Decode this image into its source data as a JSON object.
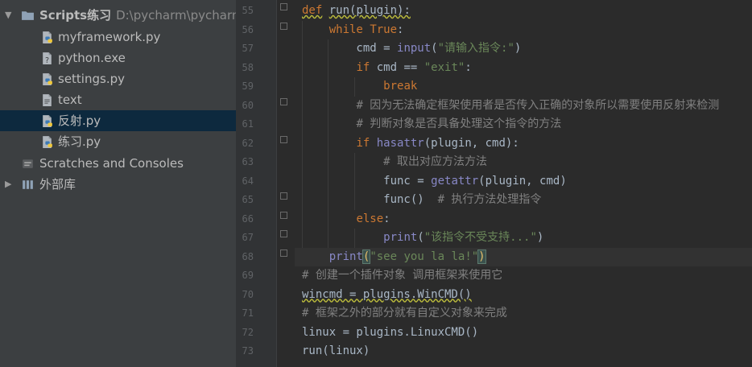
{
  "project_tree": {
    "root": {
      "name": "Scripts练习",
      "path": "D:\\pycharm\\pycharmw"
    },
    "files": [
      {
        "name": "myframework.py",
        "icon": "python-file-icon",
        "selected": false
      },
      {
        "name": "python.exe",
        "icon": "unknown-file-icon",
        "selected": false
      },
      {
        "name": "settings.py",
        "icon": "python-file-icon",
        "selected": false
      },
      {
        "name": "text",
        "icon": "text-file-icon",
        "selected": false
      },
      {
        "name": "反射.py",
        "icon": "python-file-icon",
        "selected": true
      },
      {
        "name": "练习.py",
        "icon": "python-file-icon",
        "selected": false
      }
    ],
    "scratches": "Scratches and Consoles",
    "external_libs": "外部库"
  },
  "editor": {
    "current_line": "68",
    "lines": [
      {
        "no": "55",
        "tokens": [
          {
            "t": "def",
            "c": "kw wave"
          },
          {
            "t": " ",
            "c": ""
          },
          {
            "t": "run(plugin):",
            "c": "wave"
          }
        ]
      },
      {
        "no": "56",
        "tokens": [
          {
            "t": "    ",
            "c": ""
          },
          {
            "t": "while",
            "c": "kw"
          },
          {
            "t": " ",
            "c": ""
          },
          {
            "t": "True",
            "c": "kw"
          },
          {
            "t": ":",
            "c": ""
          }
        ]
      },
      {
        "no": "57",
        "tokens": [
          {
            "t": "        cmd = ",
            "c": ""
          },
          {
            "t": "input",
            "c": "bi"
          },
          {
            "t": "(",
            "c": ""
          },
          {
            "t": "\"请输入指令:\"",
            "c": "str"
          },
          {
            "t": ")",
            "c": ""
          }
        ]
      },
      {
        "no": "58",
        "tokens": [
          {
            "t": "        ",
            "c": ""
          },
          {
            "t": "if",
            "c": "kw"
          },
          {
            "t": " cmd == ",
            "c": ""
          },
          {
            "t": "\"exit\"",
            "c": "str"
          },
          {
            "t": ":",
            "c": ""
          }
        ]
      },
      {
        "no": "59",
        "tokens": [
          {
            "t": "            ",
            "c": ""
          },
          {
            "t": "break",
            "c": "kw"
          }
        ]
      },
      {
        "no": "60",
        "tokens": [
          {
            "t": "        ",
            "c": ""
          },
          {
            "t": "# 因为无法确定框架使用者是否传入正确的对象所以需要使用反射来检测",
            "c": "cm"
          }
        ]
      },
      {
        "no": "61",
        "tokens": [
          {
            "t": "        ",
            "c": ""
          },
          {
            "t": "# 判断对象是否具备处理这个指令的方法",
            "c": "cm"
          }
        ]
      },
      {
        "no": "62",
        "tokens": [
          {
            "t": "        ",
            "c": ""
          },
          {
            "t": "if",
            "c": "kw"
          },
          {
            "t": " ",
            "c": ""
          },
          {
            "t": "hasattr",
            "c": "bi"
          },
          {
            "t": "(plugin, cmd):",
            "c": ""
          }
        ]
      },
      {
        "no": "63",
        "tokens": [
          {
            "t": "            ",
            "c": ""
          },
          {
            "t": "# 取出对应方法方法",
            "c": "cm"
          }
        ]
      },
      {
        "no": "64",
        "tokens": [
          {
            "t": "            func = ",
            "c": ""
          },
          {
            "t": "getattr",
            "c": "bi"
          },
          {
            "t": "(plugin, cmd)",
            "c": ""
          }
        ]
      },
      {
        "no": "65",
        "tokens": [
          {
            "t": "            func()  ",
            "c": ""
          },
          {
            "t": "# 执行方法处理指令",
            "c": "cm"
          }
        ]
      },
      {
        "no": "66",
        "tokens": [
          {
            "t": "        ",
            "c": ""
          },
          {
            "t": "else",
            "c": "kw"
          },
          {
            "t": ":",
            "c": ""
          }
        ]
      },
      {
        "no": "67",
        "tokens": [
          {
            "t": "            ",
            "c": ""
          },
          {
            "t": "print",
            "c": "bi"
          },
          {
            "t": "(",
            "c": ""
          },
          {
            "t": "\"该指令不受支持...\"",
            "c": "str"
          },
          {
            "t": ")",
            "c": ""
          }
        ]
      },
      {
        "no": "68",
        "tokens": [
          {
            "t": "    ",
            "c": ""
          },
          {
            "t": "print",
            "c": "bi"
          },
          {
            "t": "(",
            "c": "brk"
          },
          {
            "t": "\"see you la la!\"",
            "c": "str"
          },
          {
            "t": ")",
            "c": "brk"
          }
        ]
      },
      {
        "no": "69",
        "tokens": [
          {
            "t": "# 创建一个插件对象 调用框架来使用它",
            "c": "cm"
          }
        ]
      },
      {
        "no": "70",
        "tokens": [
          {
            "t": "wincmd = plugins.WinCMD()",
            "c": "wave"
          }
        ]
      },
      {
        "no": "71",
        "tokens": [
          {
            "t": "# 框架之外的部分就有自定义对象来完成",
            "c": "cm"
          }
        ]
      },
      {
        "no": "72",
        "tokens": [
          {
            "t": "linux = plugins.LinuxCMD()",
            "c": ""
          }
        ]
      },
      {
        "no": "73",
        "tokens": [
          {
            "t": "run(linux)",
            "c": ""
          }
        ]
      }
    ]
  }
}
